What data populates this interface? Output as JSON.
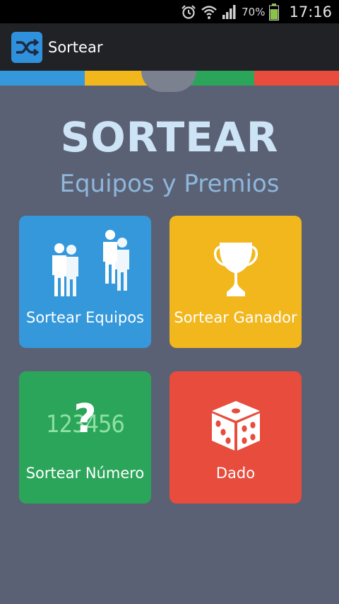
{
  "status_bar": {
    "battery_pct": "70%",
    "time": "17:16",
    "icons": [
      "alarm-icon",
      "wifi-icon",
      "signal-icon",
      "battery-icon"
    ]
  },
  "action_bar": {
    "title": "Sortear",
    "icon": "shuffle-icon"
  },
  "strip_colors": [
    "#3498db",
    "#f1b71c",
    "#2ba55a",
    "#e74c3c"
  ],
  "main": {
    "title": "SORTEAR",
    "subtitle": "Equipos y Premios"
  },
  "tiles": [
    {
      "label": "Sortear Equipos",
      "color": "#3498db",
      "icon": "teams-icon"
    },
    {
      "label": "Sortear Ganador",
      "color": "#f1b71c",
      "icon": "trophy-icon"
    },
    {
      "label": "Sortear Número",
      "color": "#2ba55a",
      "icon": "number-icon",
      "number_text": "123456",
      "question_mark": "?"
    },
    {
      "label": "Dado",
      "color": "#e74c3c",
      "icon": "dice-icon"
    }
  ]
}
